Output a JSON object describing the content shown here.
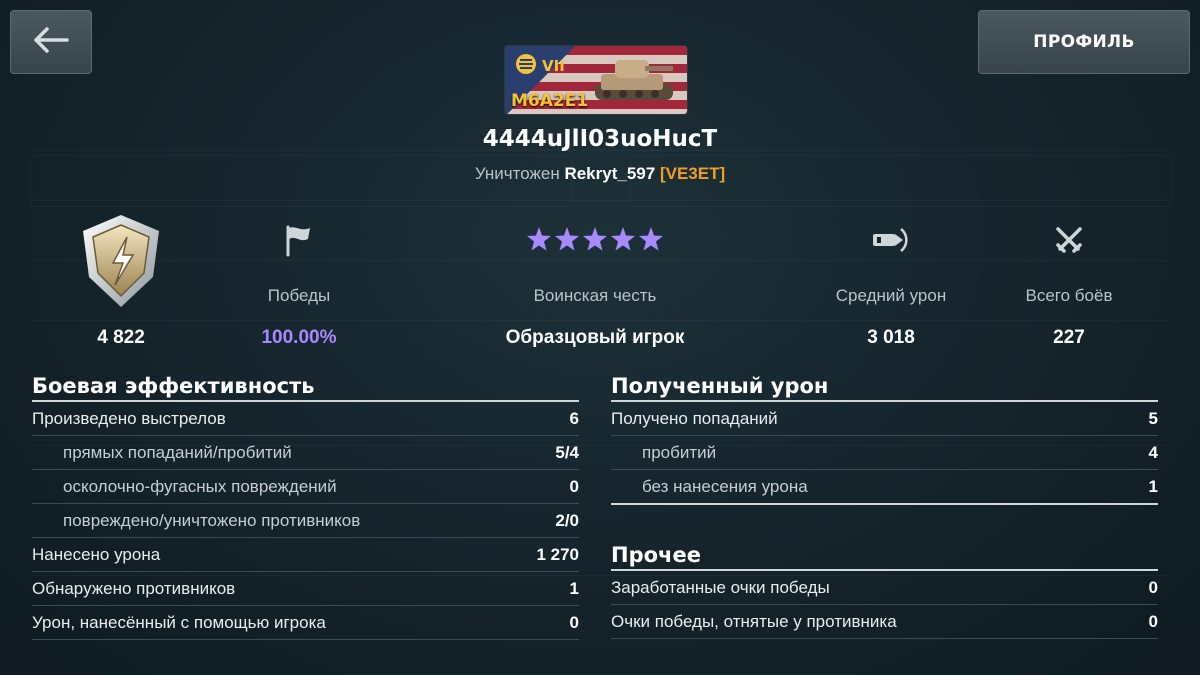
{
  "header": {
    "back_icon": "arrow-left-icon",
    "profile_label": "ПРОФИЛЬ"
  },
  "tank": {
    "tier": "VII",
    "name": "M6A2E1",
    "nation_flag": "usa"
  },
  "player": {
    "name": "4444uJlI03uoHucT",
    "destroyed_prefix": "Уничтожен",
    "killer": "Rekryt_597",
    "killer_clan": "[VE3ET]"
  },
  "stats": [
    {
      "icon": "mastery-badge-icon",
      "label": "",
      "value": "4 822"
    },
    {
      "icon": "flag-icon",
      "label": "Победы",
      "value": "100.00%"
    },
    {
      "icon": "stars-icon",
      "label": "Воинская честь",
      "value": "Образцовый игрок",
      "stars": 5
    },
    {
      "icon": "shell-damage-icon",
      "label": "Средний урон",
      "value": "3 018"
    },
    {
      "icon": "crossed-swords-icon",
      "label": "Всего боёв",
      "value": "227"
    }
  ],
  "colors": {
    "accent_purple": "#a889ff",
    "clan_orange": "#f0a020",
    "tier_gold": "#f1c33a"
  },
  "combat": {
    "title": "Боевая эффективность",
    "rows": [
      {
        "label": "Произведено выстрелов",
        "value": "6"
      },
      {
        "label": "прямых попаданий/пробитий",
        "value": "5/4"
      },
      {
        "label": "осколочно-фугасных повреждений",
        "value": "0"
      },
      {
        "label": "повреждено/уничтожено противников",
        "value": "2/0"
      },
      {
        "label": "Нанесено урона",
        "value": "1 270"
      },
      {
        "label": "Обнаружено противников",
        "value": "1"
      },
      {
        "label": "Урон, нанесённый с помощью игрока",
        "value": "0"
      }
    ]
  },
  "received": {
    "title": "Полученный урон",
    "rows": [
      {
        "label": "Получено попаданий",
        "value": "5"
      },
      {
        "label": "пробитий",
        "value": "4"
      },
      {
        "label": "без нанесения урона",
        "value": "1"
      }
    ]
  },
  "other": {
    "title": "Прочее",
    "rows": [
      {
        "label": "Заработанные очки победы",
        "value": "0"
      },
      {
        "label": "Очки победы, отнятые у противника",
        "value": "0"
      }
    ]
  }
}
